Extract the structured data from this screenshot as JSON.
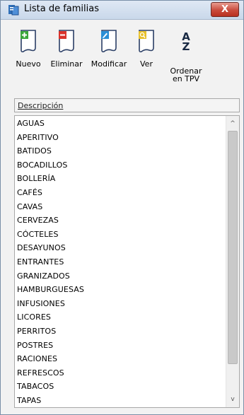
{
  "window": {
    "title": "Lista de familias",
    "close_label": "X"
  },
  "toolbar": {
    "buttons": [
      {
        "label": "Nuevo",
        "icon": "new-document-icon",
        "color": "#3aa63a"
      },
      {
        "label": "Eliminar",
        "icon": "delete-document-icon",
        "color": "#d9322b"
      },
      {
        "label": "Modificar",
        "icon": "edit-document-icon",
        "color": "#2b8fd6"
      },
      {
        "label": "Ver",
        "icon": "view-document-icon",
        "color": "#e8c02a"
      },
      {
        "label_line1": "Ordenar",
        "label_line2": "en TPV",
        "icon": "sort-az-icon",
        "glyph_top": "A",
        "glyph_bottom": "Z"
      }
    ]
  },
  "list": {
    "header": "Descripción",
    "items": [
      "AGUAS",
      "APERITIVO",
      "BATIDOS",
      "BOCADILLOS",
      "BOLLERÍA",
      "CAFÉS",
      "CAVAS",
      "CERVEZAS",
      "CÓCTELES",
      "DESAYUNOS",
      "ENTRANTES",
      "GRANIZADOS",
      "HAMBURGUESAS",
      "INFUSIONES",
      "LICORES",
      "PERRITOS",
      "POSTRES",
      "RACIONES",
      "REFRESCOS",
      "TABACOS",
      "TAPAS"
    ],
    "scroll_up": "^",
    "scroll_down": "v"
  }
}
